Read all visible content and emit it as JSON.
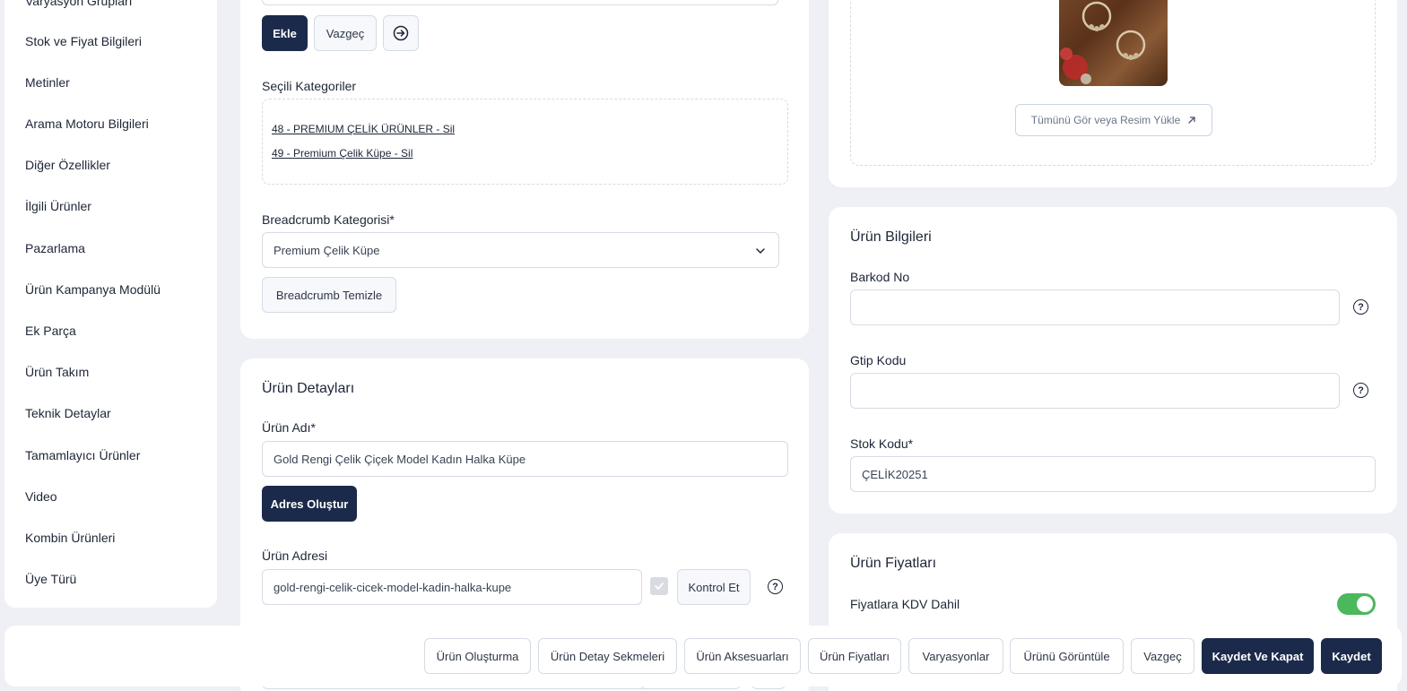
{
  "sidebar": {
    "items": [
      "Varyasyon Grupları",
      "Stok ve Fiyat Bilgileri",
      "Metinler",
      "Arama Motoru Bilgileri",
      "Diğer Özellikler",
      "İlgili Ürünler",
      "Pazarlama",
      "Ürün Kampanya Modülü",
      "Ek Parça",
      "Ürün Takım",
      "Teknik Detaylar",
      "Tamamlayıcı Ürünler",
      "Video",
      "Kombin Ürünleri",
      "Üye Türü"
    ]
  },
  "category": {
    "add_label": "Ekle",
    "cancel_label": "Vazgeç",
    "selected_title": "Seçili Kategoriler",
    "selected": [
      {
        "text": "48 - PREMIUM ÇELİK ÜRÜNLER - ",
        "remove": "Sil"
      },
      {
        "text": "49 - Premium Çelik Küpe - ",
        "remove": "Sil"
      }
    ],
    "breadcrumb_label": "Breadcrumb Kategorisi*",
    "breadcrumb_value": "Premium Çelik Küpe",
    "breadcrumb_clear": "Breadcrumb Temizle"
  },
  "details": {
    "title": "Ürün Detayları",
    "name_label": "Ürün Adı*",
    "name_value": "Gold Rengi Çelik Çiçek Model Kadın Halka Küpe",
    "create_address": "Adres Oluştur",
    "address_label": "Ürün Adresi",
    "address_value": "gold-rengi-celik-cicek-model-kadin-halka-kupe",
    "check_label": "Kontrol Et"
  },
  "image": {
    "view_upload": "Tümünü Gör veya Resim Yükle"
  },
  "info": {
    "title": "Ürün Bilgileri",
    "barcode_label": "Barkod No",
    "barcode_value": "",
    "gtip_label": "Gtip Kodu",
    "gtip_value": "",
    "stock_label": "Stok Kodu*",
    "stock_value": "ÇELİK20251"
  },
  "prices": {
    "title": "Ürün Fiyatları",
    "vat_label": "Fiyatlara KDV Dahil",
    "vat_on": true
  },
  "footer": {
    "buttons": [
      "Ürün Oluşturma",
      "Ürün Detay Sekmeleri",
      "Ürün Aksesuarları",
      "Ürün Fiyatları",
      "Varyasyonlar",
      "Ürünü Görüntüle",
      "Vazgeç"
    ],
    "save_close": "Kaydet Ve Kapat",
    "save": "Kaydet"
  },
  "colors": {
    "primary": "#1b2a4a",
    "toggle_on": "#4cb85c"
  }
}
